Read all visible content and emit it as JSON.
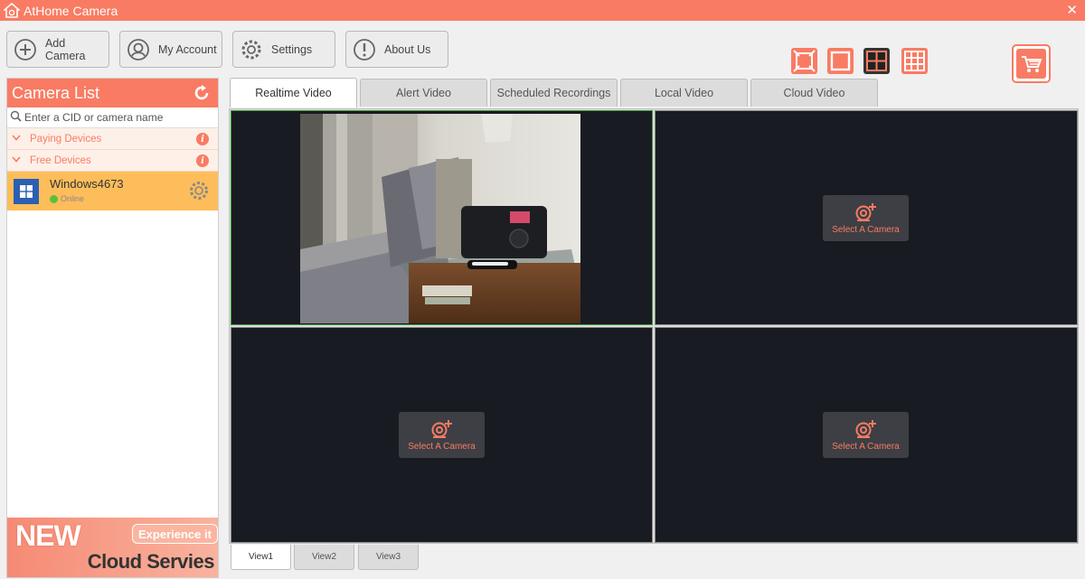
{
  "app": {
    "title": "AtHome Camera",
    "close_glyph": "✕",
    "accent": "#f97b63"
  },
  "toolbar": {
    "buttons": [
      {
        "label": "Add Camera",
        "icon": "plus-circle-icon"
      },
      {
        "label": "My Account",
        "icon": "account-icon"
      },
      {
        "label": "Settings",
        "icon": "gear-icon"
      },
      {
        "label": "About Us",
        "icon": "exclamation-circle-icon"
      }
    ],
    "layouts": [
      "fullscreen-icon",
      "single-view-icon",
      "four-view-icon",
      "nine-view-icon"
    ],
    "selected_layout": "four-view-icon",
    "cart_icon": "shopping-cart-icon"
  },
  "sidebar": {
    "title": "Camera List",
    "search_placeholder": "Enter a CID or camera name",
    "groups": [
      {
        "label": "Paying Devices",
        "info": "i"
      },
      {
        "label": "Free Devices",
        "info": "i"
      }
    ],
    "devices": [
      {
        "name": "Windows4673",
        "status": "Online",
        "status_color": "#52c43b",
        "icon": "windows-icon"
      }
    ],
    "promo": {
      "new": "NEW",
      "badge": "Experience it",
      "text": "Cloud Servies"
    }
  },
  "tabs": [
    {
      "label": "Realtime Video",
      "active": true
    },
    {
      "label": "Alert Video",
      "active": false
    },
    {
      "label": "Scheduled Recordings",
      "active": false
    },
    {
      "label": "Local Video",
      "active": false
    },
    {
      "label": "Cloud Video",
      "active": false
    }
  ],
  "video_grid": {
    "select_label": "Select A Camera"
  },
  "view_tabs": [
    {
      "label": "View1",
      "active": true
    },
    {
      "label": "View2",
      "active": false
    },
    {
      "label": "View3",
      "active": false
    }
  ]
}
